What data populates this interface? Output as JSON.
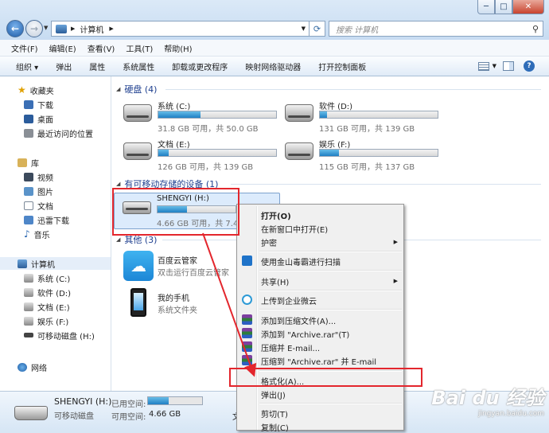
{
  "window": {
    "title_controls": [
      "─",
      "□",
      "✕"
    ],
    "address": {
      "computer_label": "计算机"
    },
    "search_placeholder": "搜索 计算机"
  },
  "menubar": [
    "文件(F)",
    "编辑(E)",
    "查看(V)",
    "工具(T)",
    "帮助(H)"
  ],
  "toolbar": [
    "组织 ▾",
    "弹出",
    "属性",
    "系统属性",
    "卸载或更改程序",
    "映射网络驱动器",
    "打开控制面板"
  ],
  "sidebar": {
    "favorites": {
      "label": "收藏夹",
      "items": [
        "下载",
        "桌面",
        "最近访问的位置"
      ]
    },
    "libraries": {
      "label": "库",
      "items": [
        "视频",
        "图片",
        "文档",
        "迅雷下载",
        "音乐"
      ]
    },
    "computer": {
      "label": "计算机",
      "items": [
        "系统 (C:)",
        "软件 (D:)",
        "文档 (E:)",
        "娱乐 (F:)",
        "可移动磁盘 (H:)"
      ]
    },
    "network": {
      "label": "网络"
    }
  },
  "groups": {
    "hdd": {
      "header": "硬盘 (4)",
      "drives": [
        {
          "name": "系统 (C:)",
          "free_text": "31.8 GB 可用，共 50.0 GB",
          "used_fraction": 0.36
        },
        {
          "name": "软件 (D:)",
          "free_text": "131 GB 可用，共 139 GB",
          "used_fraction": 0.06
        },
        {
          "name": "文档 (E:)",
          "free_text": "126 GB 可用，共 139 GB",
          "used_fraction": 0.09
        },
        {
          "name": "娱乐 (F:)",
          "free_text": "115 GB 可用，共 137 GB",
          "used_fraction": 0.16
        }
      ]
    },
    "removable": {
      "header": "有可移动存储的设备 (1)",
      "drive": {
        "name": "SHENGYI (H:)",
        "free_text": "4.66 GB 可用，共 7.47",
        "used_fraction": 0.38
      }
    },
    "other": {
      "header": "其他 (3)",
      "items": [
        {
          "name": "百度云管家",
          "desc": "双击运行百度云管家"
        },
        {
          "name": "我的手机",
          "desc": "系统文件夹"
        }
      ]
    }
  },
  "statusbar": {
    "drive_name": "SHENGYI (H:)",
    "drive_type": "可移动磁盘",
    "used_label": "已用空间:",
    "free_label": "可用空间:",
    "free_value": "4.66 GB",
    "used_fraction": 0.38,
    "cut_char": "文"
  },
  "context_menu": [
    {
      "label": "打开(O)",
      "bold": true
    },
    {
      "label": "在新窗口中打开(E)"
    },
    {
      "label": "护密",
      "submenu": true
    },
    {
      "separator": true
    },
    {
      "label": "使用金山毒霸进行扫描",
      "icon": "shield-icon"
    },
    {
      "separator": true
    },
    {
      "label": "共享(H)",
      "submenu": true
    },
    {
      "separator": true
    },
    {
      "label": "上传到企业微云",
      "icon": "cloud-icon"
    },
    {
      "separator": true
    },
    {
      "label": "添加到压缩文件(A)...",
      "icon": "winrar-icon"
    },
    {
      "label": "添加到 \"Archive.rar\"(T)",
      "icon": "winrar-icon"
    },
    {
      "label": "压缩并 E-mail...",
      "icon": "winrar-icon"
    },
    {
      "label": "压缩到 \"Archive.rar\" 并 E-mail",
      "icon": "winrar-icon"
    },
    {
      "separator": true
    },
    {
      "label": "格式化(A)..."
    },
    {
      "label": "弹出(J)"
    },
    {
      "separator": true
    },
    {
      "label": "剪切(T)"
    },
    {
      "label": "复制(C)"
    }
  ],
  "watermark": {
    "line1": "Bai du 经验",
    "line2": "jingyan.baidu.com"
  },
  "colors": {
    "highlight": "#e3262d",
    "bar_fill": "#1f7fc4",
    "header_text": "#1e3f8f"
  }
}
